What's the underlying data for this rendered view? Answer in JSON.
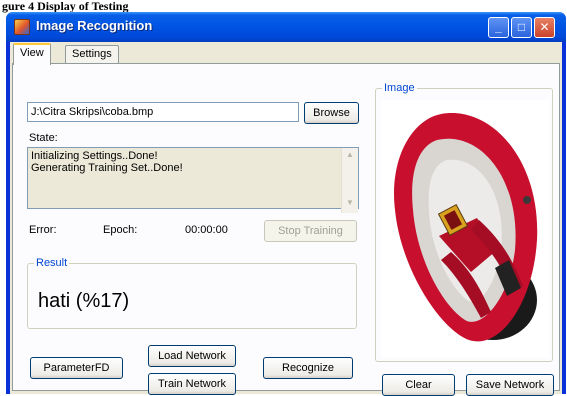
{
  "caption": "gure 4 Display of Testing",
  "window": {
    "title": "Image Recognition",
    "controls": {
      "minimize": "_",
      "maximize": "□",
      "close": "✕"
    }
  },
  "tabs": [
    {
      "label": "View",
      "active": true
    },
    {
      "label": "Settings",
      "active": false
    }
  ],
  "file": {
    "path": "J:\\Citra Skripsi\\coba.bmp",
    "browse_label": "Browse"
  },
  "state": {
    "label": "State:",
    "lines": [
      "Initializing Settings..Done!",
      "Generating Training Set..Done!"
    ]
  },
  "stats": {
    "error_label": "Error:",
    "epoch_label": "Epoch:",
    "time": "00:00:00",
    "stop_training_label": "Stop Training"
  },
  "result": {
    "title": "Result",
    "value": "hati (%17)"
  },
  "buttons": {
    "parameter_fd": "ParameterFD",
    "load_network": "Load Network",
    "train_network": "Train Network",
    "recognize": "Recognize",
    "clear": "Clear",
    "save_network": "Save Network"
  },
  "image_panel": {
    "title": "Image"
  },
  "colors": {
    "titlebar": "#0055e5",
    "group_title": "#0046d5",
    "sandal_red": "#c8102e"
  }
}
